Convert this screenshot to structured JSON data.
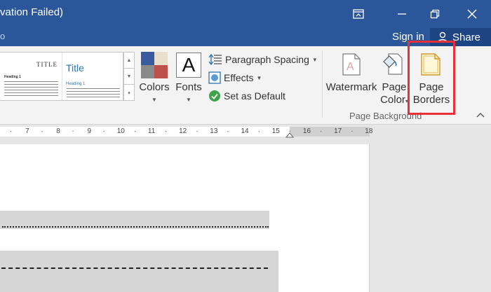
{
  "titlebar": {
    "title": "vation Failed)"
  },
  "tellbar": {
    "signin_label": "Sign in",
    "share_label": "Share"
  },
  "ribbon": {
    "styles": {
      "thumb1_title": "TITLE",
      "thumb1_heading": "Heading 1",
      "thumb2_title": "Title",
      "thumb2_heading": "Heading 1"
    },
    "colors_label": "Colors",
    "fonts_label": "Fonts",
    "fonts_glyph": "A",
    "paragraph_spacing_label": "Paragraph Spacing",
    "effects_label": "Effects",
    "set_default_label": "Set as Default",
    "watermark_label": "Watermark",
    "page_color_label_1": "Page",
    "page_color_label_2": "Color",
    "page_borders_label_1": "Page",
    "page_borders_label_2": "Borders",
    "group_label": "Page Background",
    "accent_colors": [
      "#3a5ba0",
      "#c0504d",
      "#e8e0cc",
      "#8a8a8a"
    ]
  },
  "ruler": {
    "ticks": [
      "·",
      "7",
      "·",
      "8",
      "·",
      "9",
      "·",
      "10",
      "·",
      "11",
      "·",
      "12",
      "·",
      "13",
      "·",
      "14",
      "·",
      "15",
      "·",
      "16",
      "·",
      "17",
      "·",
      "18"
    ]
  }
}
